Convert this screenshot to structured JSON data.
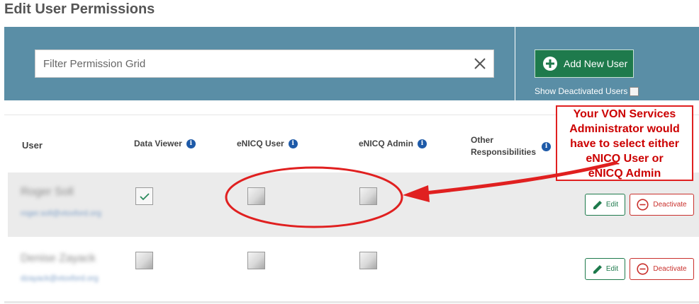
{
  "page": {
    "title": "Edit User Permissions"
  },
  "filter": {
    "placeholder": "Filter Permission Grid",
    "value": ""
  },
  "actions": {
    "add_user_label": "Add New User",
    "show_deactivated_label": "Show Deactivated Users",
    "show_deactivated_checked": false
  },
  "table": {
    "headers": {
      "user": "User",
      "data_viewer": "Data Viewer",
      "enicq_user": "eNICQ User",
      "enicq_admin": "eNICQ Admin",
      "other_line1": "Other",
      "other_line2": "Responsibilities"
    },
    "info_glyph": "i",
    "rows": [
      {
        "name": "Roger Soll",
        "email": "roger.soll@vtoxford.org",
        "data_viewer": true,
        "enicq_user": false,
        "enicq_admin": false,
        "edit_label": "Edit",
        "deactivate_label": "Deactivate"
      },
      {
        "name": "Denise Zayack",
        "email": "dzayack@vtoxford.org",
        "data_viewer": false,
        "enicq_user": false,
        "enicq_admin": false,
        "edit_label": "Edit",
        "deactivate_label": "Deactivate"
      }
    ]
  },
  "annotation": {
    "lines": [
      "Your VON Services",
      "Administrator would",
      "have to select either",
      "eNICQ User or",
      "eNICQ Admin"
    ],
    "color": "#e02020"
  },
  "colors": {
    "header_band": "#5a8ea6",
    "add_button": "#1e7a4c",
    "deactivate": "#c9302c",
    "info_icon": "#1e5aa8"
  }
}
